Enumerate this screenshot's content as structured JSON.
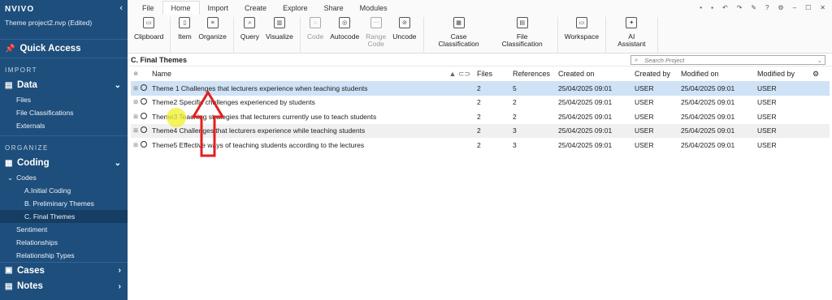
{
  "app": {
    "logo": "NVIVO",
    "project": "Theme project2.nvp (Edited)"
  },
  "sidebar": {
    "quick_access": "Quick Access",
    "import_label": "IMPORT",
    "data_label": "Data",
    "data_items": [
      "Files",
      "File Classifications",
      "Externals"
    ],
    "organize_label": "ORGANIZE",
    "coding_label": "Coding",
    "codes_label": "Codes",
    "codes_items": [
      "A.Initial Coding",
      "B. Preliminary Themes",
      "C. Final Themes"
    ],
    "coding_items": [
      "Sentiment",
      "Relationships",
      "Relationship Types"
    ],
    "cases_label": "Cases",
    "notes_label": "Notes"
  },
  "ribbon": {
    "tabs": [
      "File",
      "Home",
      "Import",
      "Create",
      "Explore",
      "Share",
      "Modules"
    ],
    "buttons": {
      "clipboard": "Clipboard",
      "item": "Item",
      "organize": "Organize",
      "query": "Query",
      "visualize": "Visualize",
      "code": "Code",
      "autocode": "Autocode",
      "range_code_1": "Range",
      "range_code_2": "Code",
      "uncode": "Uncode",
      "case_class_1": "Case",
      "case_class_2": "Classification",
      "file_class_1": "File",
      "file_class_2": "Classification",
      "workspace": "Workspace",
      "ai_1": "AI",
      "ai_2": "Assistant"
    }
  },
  "main": {
    "title": "C. Final Themes",
    "search_placeholder": "Search Project",
    "columns": {
      "name": "Name",
      "files": "Files",
      "references": "References",
      "created_on": "Created on",
      "created_by": "Created by",
      "modified_on": "Modified on",
      "modified_by": "Modified by"
    },
    "rows": [
      {
        "name": "Theme 1 Challenges that lecturers experience when teaching students",
        "files": "2",
        "references": "5",
        "created_on": "25/04/2025 09:01",
        "created_by": "USER",
        "modified_on": "25/04/2025 09:01",
        "modified_by": "USER"
      },
      {
        "name": "Theme2 Specific challenges experienced by students",
        "files": "2",
        "references": "2",
        "created_on": "25/04/2025 09:01",
        "created_by": "USER",
        "modified_on": "25/04/2025 09:01",
        "modified_by": "USER"
      },
      {
        "name": "Theme3 Teaching strategies that lecturers currently use to teach students",
        "files": "2",
        "references": "2",
        "created_on": "25/04/2025 09:01",
        "created_by": "USER",
        "modified_on": "25/04/2025 09:01",
        "modified_by": "USER"
      },
      {
        "name": "Theme4 Challenges that lecturers experience while teaching students",
        "files": "2",
        "references": "3",
        "created_on": "25/04/2025 09:01",
        "created_by": "USER",
        "modified_on": "25/04/2025 09:01",
        "modified_by": "USER"
      },
      {
        "name": "Theme5 Effective ways of teaching students according to the lectures",
        "files": "2",
        "references": "3",
        "created_on": "25/04/2025 09:01",
        "created_by": "USER",
        "modified_on": "25/04/2025 09:01",
        "modified_by": "USER"
      }
    ]
  },
  "colors": {
    "sidebar": "#1e4e7c",
    "selected_row": "#cfe2f6",
    "annotation_arrow": "#e02020",
    "highlight": "#f0f028"
  }
}
